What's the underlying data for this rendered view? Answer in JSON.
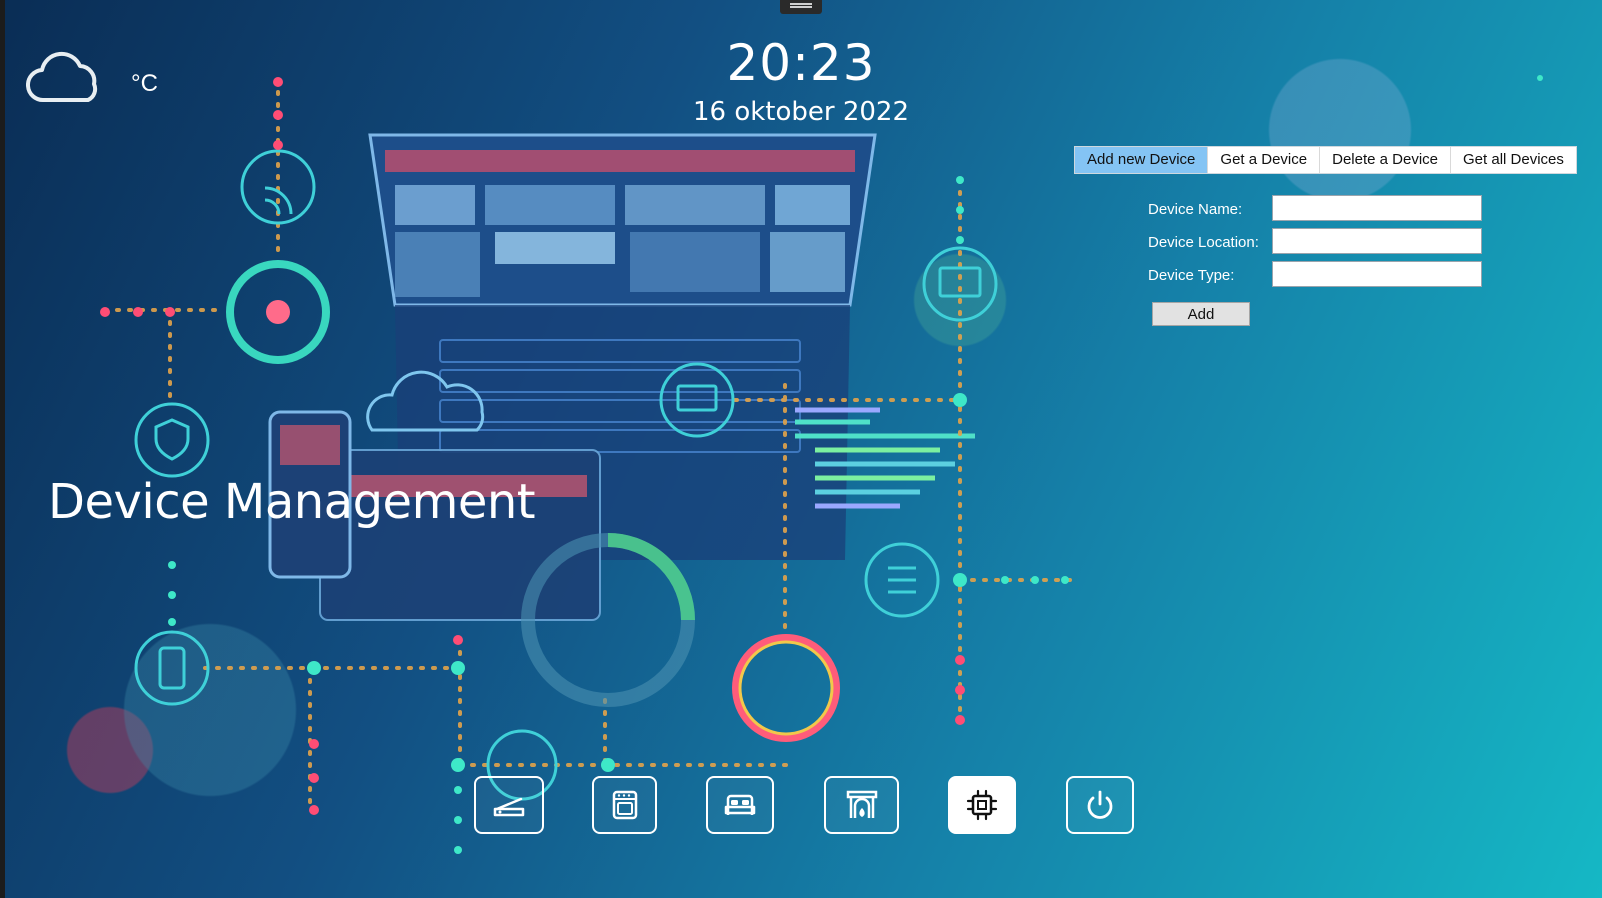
{
  "weather": {
    "icon": "cloud-icon",
    "temperature": "°C"
  },
  "clock": {
    "time": "20:23",
    "date": "16 oktober 2022"
  },
  "page_title": "Device Management",
  "tabs": [
    {
      "label": "Add new Device",
      "active": true
    },
    {
      "label": "Get a Device",
      "active": false
    },
    {
      "label": "Delete a Device",
      "active": false
    },
    {
      "label": "Get all Devices",
      "active": false
    }
  ],
  "form": {
    "device_name_label": "Device Name:",
    "device_name_value": "",
    "device_location_label": "Device Location:",
    "device_location_value": "",
    "device_type_label": "Device Type:",
    "device_type_value": "",
    "add_label": "Add"
  },
  "nav": [
    {
      "icon": "scanner-icon",
      "active": false
    },
    {
      "icon": "oven-icon",
      "active": false
    },
    {
      "icon": "bed-icon",
      "active": false
    },
    {
      "icon": "fireplace-icon",
      "active": false
    },
    {
      "icon": "chip-icon",
      "active": true
    },
    {
      "icon": "power-icon",
      "active": false
    }
  ],
  "colors": {
    "tab_active": "#84c4f4",
    "background_start": "#0a2d55",
    "background_end": "#15b8c5",
    "text": "#ffffff"
  }
}
